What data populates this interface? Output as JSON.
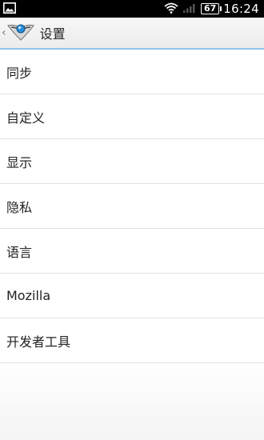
{
  "status_bar": {
    "time": "16:24",
    "battery": "67",
    "icons": [
      "notification-image-icon",
      "wifi-icon",
      "signal-icon",
      "battery-icon"
    ]
  },
  "action_bar": {
    "title": "设置",
    "icons": [
      "up-caret-icon",
      "app-logo-icon"
    ]
  },
  "menu": {
    "items": [
      {
        "label": "同步"
      },
      {
        "label": "自定义"
      },
      {
        "label": "显示"
      },
      {
        "label": "隐私"
      },
      {
        "label": "语言"
      },
      {
        "label": "Mozilla"
      },
      {
        "label": "开发者工具"
      }
    ]
  },
  "colors": {
    "statusbar_bg": "#000000",
    "accent_line": "#8ec6e8",
    "text": "#222222"
  }
}
